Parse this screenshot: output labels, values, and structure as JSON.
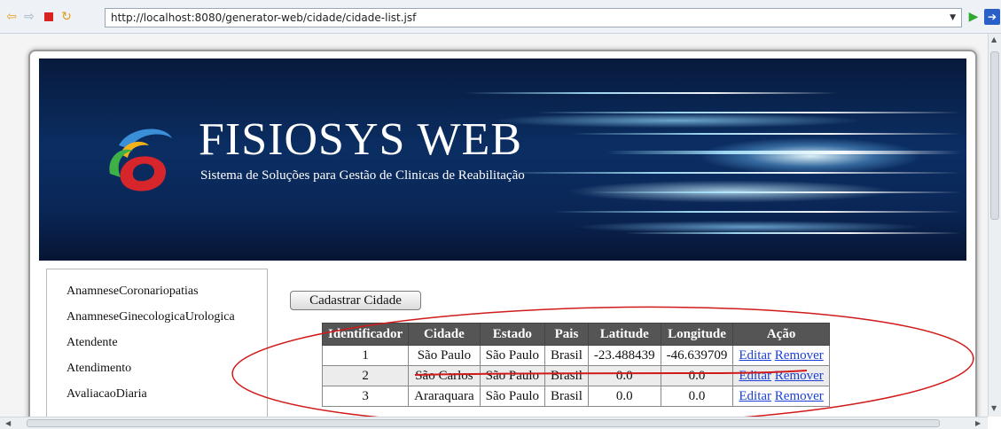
{
  "browser": {
    "url": "http://localhost:8080/generator-web/cidade/cidade-list.jsf",
    "icons": [
      "back-icon",
      "forward-icon",
      "stop-icon",
      "refresh-icon",
      "dropdown-icon",
      "go-icon",
      "extension-icon"
    ]
  },
  "header": {
    "title": "FISIOSYS WEB",
    "subtitle": "Sistema de Soluções para Gestão de Clinicas de Reabilitação"
  },
  "sidebar": {
    "items": [
      {
        "label": "AnamneseCoronariopatias"
      },
      {
        "label": "AnamneseGinecologicaUrologica"
      },
      {
        "label": "Atendente"
      },
      {
        "label": "Atendimento"
      },
      {
        "label": "AvaliacaoDiaria"
      }
    ]
  },
  "main": {
    "add_button_label": "Cadastrar Cidade",
    "table": {
      "columns": [
        "Identificador",
        "Cidade",
        "Estado",
        "Pais",
        "Latitude",
        "Longitude",
        "Ação"
      ],
      "rows": [
        {
          "id": "1",
          "cidade": "São Paulo",
          "estado": "São Paulo",
          "pais": "Brasil",
          "latitude": "-23.488439",
          "longitude": "-46.639709"
        },
        {
          "id": "2",
          "cidade": "São Carlos",
          "estado": "São Paulo",
          "pais": "Brasil",
          "latitude": "0.0",
          "longitude": "0.0"
        },
        {
          "id": "3",
          "cidade": "Araraquara",
          "estado": "São Paulo",
          "pais": "Brasil",
          "latitude": "0.0",
          "longitude": "0.0"
        }
      ],
      "edit_label": "Editar",
      "remove_label": "Remover"
    }
  },
  "colors": {
    "table_header": "#555555",
    "link": "#1a3fd6",
    "annotation": "#d11a1a"
  }
}
